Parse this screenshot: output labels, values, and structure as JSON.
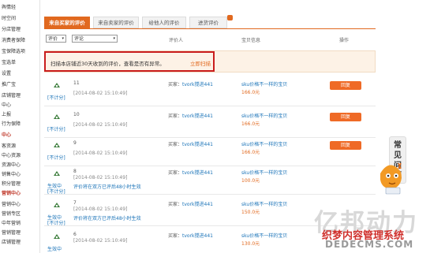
{
  "sidebar": {
    "items": [
      "舆情轻",
      "时空间",
      "分店管理",
      "消费者保障",
      "宝保障选项",
      "宝选单",
      "设置",
      "推广宝",
      "店铺管理",
      "中心",
      "上报",
      "行为保障"
    ],
    "section1": "中心",
    "items2": [
      "客资源",
      "中心资源",
      "资源中心",
      "销售中心",
      "积分管理"
    ],
    "section2": "营销中心",
    "items3": [
      "营销中心",
      "营销专区",
      "中年营销",
      "营销管理",
      "店铺管理"
    ]
  },
  "tabs": [
    {
      "label": "来自买家的评价",
      "active": true
    },
    {
      "label": "来自卖家的评价",
      "active": false
    },
    {
      "label": "给他人的评价",
      "active": false
    },
    {
      "label": "进货评价",
      "active": false
    }
  ],
  "filters": {
    "rating_select": "评价",
    "comment_select": "评论"
  },
  "columns": {
    "evaluator": "评价人",
    "item_info": "宝贝信息",
    "action": "操作"
  },
  "notice": {
    "text": "扫描本店铺近30天收到的评价，查看是否有异常。",
    "link": "立即扫描"
  },
  "rows": [
    {
      "id": "11",
      "time": "[2014-08-02 15:10:49]",
      "status": "[不计分]",
      "buyer_label": "买家：",
      "buyer": "tvork搅进441",
      "item": "sku价格不一样的宝贝",
      "price": "166.0元",
      "reply": "回复"
    },
    {
      "id": "10",
      "time": "[2014-08-02 15:10:49]",
      "status": "[不计分]",
      "buyer_label": "买家：",
      "buyer": "tvork搅进441",
      "item": "sku价格不一样的宝贝",
      "price": "166.0元",
      "reply": "回复"
    },
    {
      "id": "9",
      "time": "[2014-08-02 15:10:49]",
      "status": "[不计分]",
      "buyer_label": "买家：",
      "buyer": "tvork搅进441",
      "item": "sku价格不一样的宝贝",
      "price": "166.0元",
      "reply": "回复"
    },
    {
      "id": "8",
      "time": "[2014-08-02 15:10:49]",
      "status": "生效中",
      "status2": "[不计分]",
      "note": "评价将在双方已评后48小时生效",
      "buyer_label": "买家：",
      "buyer": "tvork搅进441",
      "item": "sku价格不一样的宝贝",
      "price": "100.0元"
    },
    {
      "id": "7",
      "time": "[2014-08-02 15:10:49]",
      "status": "生效中",
      "status2": "[不计分]",
      "note": "评价将在双方已评后48小时生效",
      "buyer_label": "买家：",
      "buyer": "tvork搅进441",
      "item": "sku价格不一样的宝贝",
      "price": "150.0元"
    },
    {
      "id": "6",
      "time": "[2014-08-02 15:10:49]",
      "status": "生效中",
      "buyer_label": "买家：",
      "buyer": "tvork搅进441",
      "item": "sku价格不一样的宝贝",
      "price": "130.0元"
    }
  ],
  "help_widget": {
    "label": "常见问题"
  },
  "watermark": {
    "brand": "亿邦动力",
    "subtitle": "织梦内容管理系统",
    "url": "DEDECMS.COM"
  },
  "colors": {
    "accent": "#e1691f",
    "link": "#1a73b8",
    "highlight_border": "#c91d1d",
    "notice_bg": "#fdf2e6"
  }
}
